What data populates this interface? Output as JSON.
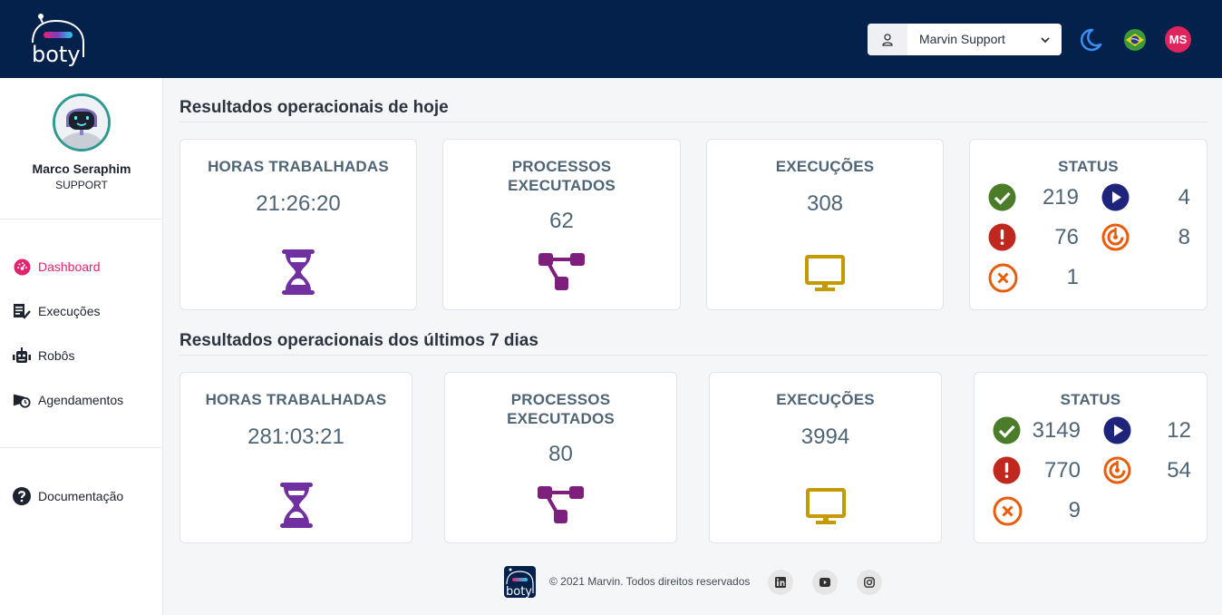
{
  "header": {
    "logo_text": "boty",
    "user_select": {
      "value": "Marvin Support",
      "icon": "user-icon"
    },
    "theme_icon": "moon-icon",
    "language_icon": "brazil-flag-icon",
    "avatar_initials": "MS"
  },
  "sidebar": {
    "profile": {
      "name": "Marco Seraphim",
      "role": "SUPPORT"
    },
    "items": [
      {
        "label": "Dashboard",
        "icon": "dashboard-gauge-icon",
        "active": true
      },
      {
        "label": "Execuções",
        "icon": "executions-list-icon",
        "active": false
      },
      {
        "label": "Robôs",
        "icon": "robot-icon",
        "active": false
      },
      {
        "label": "Agendamentos",
        "icon": "schedule-clock-icon",
        "active": false
      }
    ],
    "documentation": {
      "label": "Documentação",
      "icon": "question-circle-icon"
    }
  },
  "today": {
    "title": "Resultados operacionais de hoje",
    "hours": {
      "label": "HORAS TRABALHADAS",
      "value": "21:26:20"
    },
    "processes": {
      "label_line1": "PROCESSOS",
      "label_line2": "EXECUTADOS",
      "value": "62"
    },
    "executions": {
      "label": "EXECUÇÕES",
      "value": "308"
    },
    "status": {
      "label": "STATUS",
      "success": "219",
      "running": "4",
      "error": "76",
      "waiting": "8",
      "cancelled": "1"
    }
  },
  "week": {
    "title": "Resultados operacionais dos últimos 7 dias",
    "hours": {
      "label": "HORAS TRABALHADAS",
      "value": "281:03:21"
    },
    "processes": {
      "label_line1": "PROCESSOS",
      "label_line2": "EXECUTADOS",
      "value": "80"
    },
    "executions": {
      "label": "EXECUÇÕES",
      "value": "3994"
    },
    "status": {
      "label": "STATUS",
      "success": "3149",
      "running": "12",
      "error": "770",
      "waiting": "54",
      "cancelled": "9"
    }
  },
  "footer": {
    "copyright": "© 2021 Marvin. Todos direitos reservados",
    "social": [
      "linkedin-icon",
      "youtube-icon",
      "instagram-icon"
    ]
  },
  "colors": {
    "header_bg": "#03214a",
    "accent_pink": "#e0246f",
    "hourglass": "#7030a0",
    "processes": "#7e1f7e",
    "monitor": "#c49a00",
    "success": "#4a7c2a",
    "running": "#1e2479",
    "error": "#c0271e",
    "waiting": "#e85d0c",
    "cancelled": "#e85d0c"
  }
}
